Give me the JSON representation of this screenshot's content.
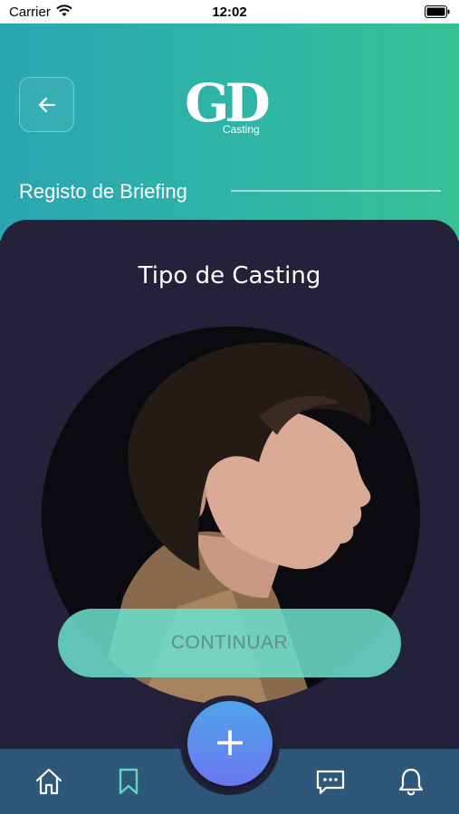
{
  "status_bar": {
    "carrier": "Carrier",
    "time": "12:02"
  },
  "header": {
    "logo_mark": "GD",
    "logo_sub": "Casting",
    "section_title": "Registo de Briefing"
  },
  "card": {
    "title": "Tipo de Casting",
    "continue_label": "CONTINUAR"
  },
  "fab": {
    "label": "+"
  },
  "tab_bar": {
    "items": [
      {
        "icon": "home-icon"
      },
      {
        "icon": "bookmark-icon"
      },
      {
        "icon": "chat-icon"
      },
      {
        "icon": "bell-icon"
      }
    ]
  },
  "colors": {
    "header_gradient_start": "#2aa6b2",
    "header_gradient_end": "#38c193",
    "card_background": "#23223a",
    "button": "#6cdfcd",
    "tab_bar": "#2f577a",
    "fab": "#5b8cee"
  }
}
